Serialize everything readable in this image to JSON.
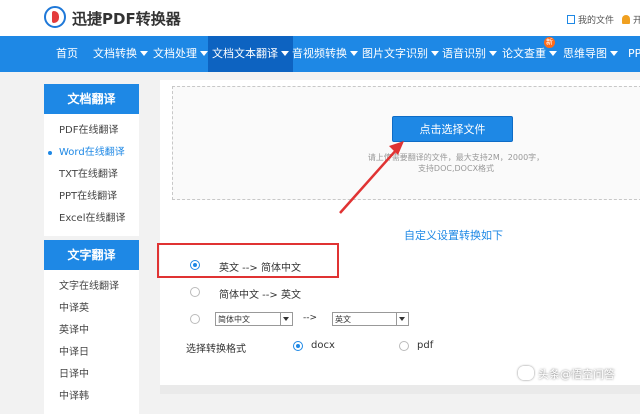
{
  "header": {
    "logo_text": "迅捷PDF转换器",
    "my_files": "我的文件",
    "extra": "开"
  },
  "nav": {
    "items": [
      {
        "label": "首页",
        "caret": false
      },
      {
        "label": "文档转换",
        "caret": true
      },
      {
        "label": "文档处理",
        "caret": true
      },
      {
        "label": "文档文本翻译",
        "caret": true,
        "active": true
      },
      {
        "label": "音视频转换",
        "caret": true
      },
      {
        "label": "图片文字识别",
        "caret": true
      },
      {
        "label": "语音识别",
        "caret": true
      },
      {
        "label": "论文查重",
        "caret": true
      },
      {
        "label": "思维导图",
        "caret": true
      },
      {
        "label": "PP",
        "caret": false
      }
    ],
    "badge": "新"
  },
  "sidebar": {
    "doc_title": "文档翻译",
    "doc_items": [
      "PDF在线翻译",
      "Word在线翻译",
      "TXT在线翻译",
      "PPT在线翻译",
      "Excel在线翻译"
    ],
    "active_item": "Word在线翻译",
    "text_title": "文字翻译",
    "text_items": [
      "文字在线翻译",
      "中译英",
      "英译中",
      "中译日",
      "日译中",
      "中译韩"
    ]
  },
  "upload": {
    "button_label": "点击选择文件",
    "hint_line1": "请上传需要翻译的文件，最大支持2M，2000字，",
    "hint_line2": "支持DOC,DOCX格式"
  },
  "settings": {
    "title": "自定义设置转换如下",
    "option1": "英文 --> 简体中文",
    "option2": "简体中文 --> 英文",
    "from_select": "简体中文",
    "arrow": "-->",
    "to_select": "英文",
    "format_label": "选择转换格式",
    "format_docx": "docx",
    "format_pdf": "pdf"
  },
  "watermark": "头条@悟空问答",
  "colors": {
    "brand_blue": "#1e88e5",
    "highlight_red": "#e03333"
  }
}
